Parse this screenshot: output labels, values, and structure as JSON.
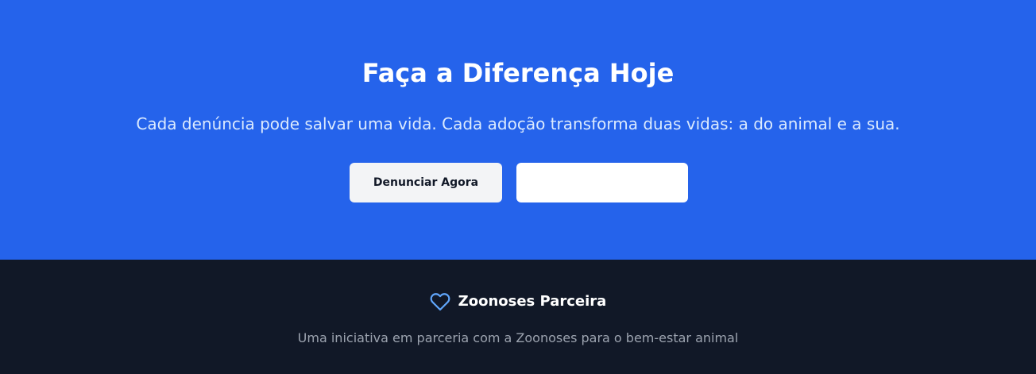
{
  "cta": {
    "title": "Faça a Diferença Hoje",
    "subtitle": "Cada denúncia pode salvar uma vida. Cada adoção transforma duas vidas: a do animal e a sua.",
    "report_button_label": "Denunciar Agora",
    "adopt_button_label": ""
  },
  "footer": {
    "brand_icon": "heart-icon",
    "brand_name": "Zoonoses Parceira",
    "tagline": "Uma iniciativa em parceria com a Zoonoses para o bem-estar animal"
  },
  "colors": {
    "primary": "#2563eb",
    "footer_bg": "#111827",
    "heart": "#60a5fa"
  }
}
